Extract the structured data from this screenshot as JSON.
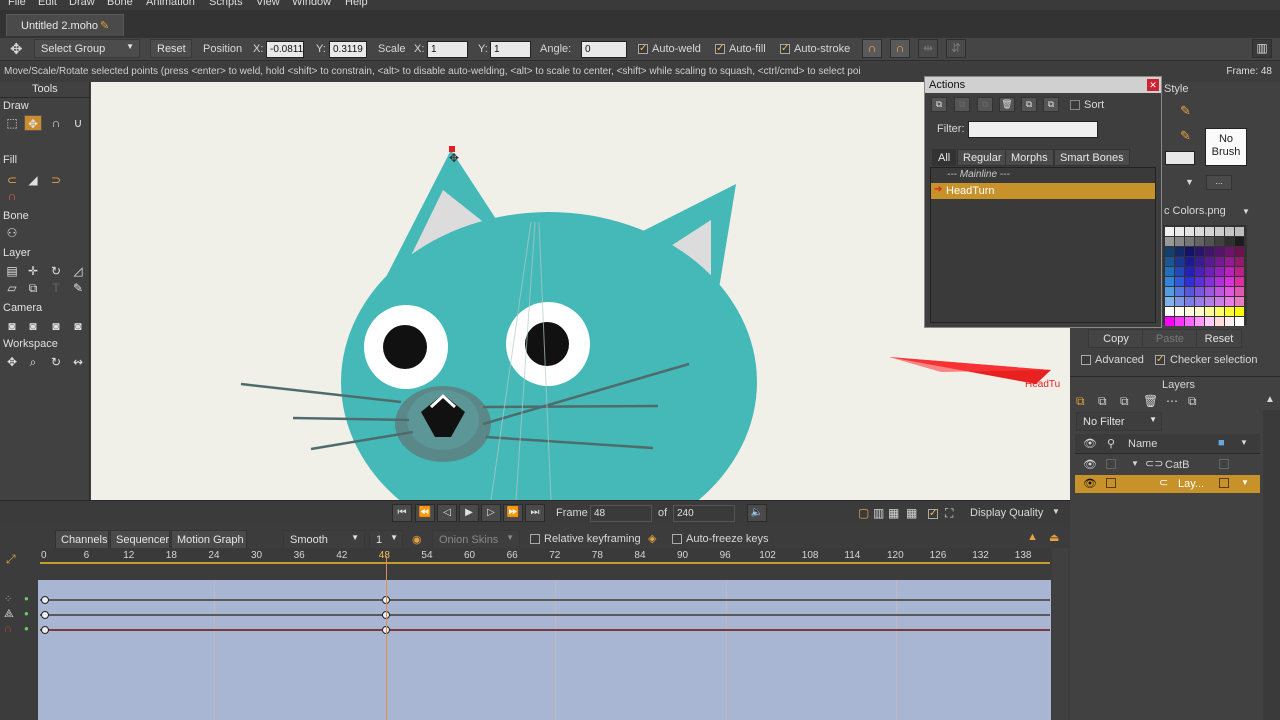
{
  "menubar": {
    "items": [
      "File",
      "Edit",
      "Draw",
      "Bone",
      "Animation",
      "Scripts",
      "View",
      "Window",
      "Help"
    ]
  },
  "document_tab": {
    "title": "Untitled 2.moho",
    "modified_icon": "pencil-icon"
  },
  "tool_options": {
    "select_group_label": "Select Group",
    "reset_label": "Reset",
    "position_label": "Position",
    "x_label": "X:",
    "x_value": "-0.0811",
    "y_label": "Y:",
    "y_value": "0.3119",
    "scale_label": "Scale",
    "scale_x_value": "1",
    "scale_y_value": "1",
    "angle_label": "Angle:",
    "angle_value": "0",
    "auto_weld": "Auto-weld",
    "auto_fill": "Auto-fill",
    "auto_stroke": "Auto-stroke"
  },
  "status": {
    "message": "Move/Scale/Rotate selected points (press <enter> to weld, hold <shift> to constrain, <alt> to disable auto-welding, <alt> to scale to center, <shift> while scaling to squash, <ctrl/cmd> to select poi",
    "frame_indicator": "Frame: 48"
  },
  "tools": {
    "title": "Tools",
    "sections": [
      "Draw",
      "Fill",
      "Bone",
      "Layer",
      "Camera",
      "Workspace"
    ]
  },
  "canvas": {
    "arrow_label": "HeadTu"
  },
  "timeline_controls": {
    "frame_label": "Frame",
    "frame_value": "48",
    "of_label": "of",
    "total_frames": "240",
    "display_quality": "Display Quality"
  },
  "timeline": {
    "tabs": [
      "Channels",
      "Sequencer",
      "Motion Graph"
    ],
    "interpolation": "Smooth",
    "interp_value": "1",
    "onion_skins": "Onion Skins",
    "relative_keyframing": "Relative keyframing",
    "auto_freeze": "Auto-freeze keys",
    "ruler_ticks": [
      0,
      6,
      12,
      18,
      24,
      30,
      36,
      42,
      48,
      54,
      60,
      66,
      72,
      78,
      84,
      90,
      96,
      102,
      108,
      114,
      120,
      126,
      132,
      138
    ],
    "current_frame": 48
  },
  "actions_panel": {
    "title": "Actions",
    "sort_label": "Sort",
    "filter_label": "Filter:",
    "filter_value": "",
    "tabs": [
      "All",
      "Regular",
      "Morphs",
      "Smart Bones"
    ],
    "items": [
      {
        "label": "--- Mainline ---",
        "selected": false
      },
      {
        "label": "HeadTurn",
        "selected": true
      }
    ]
  },
  "style_panel": {
    "title": "Style",
    "no_brush": "No Brush",
    "palette_name": "c Colors.png",
    "copy": "Copy",
    "paste": "Paste",
    "reset": "Reset",
    "advanced": "Advanced",
    "checker_selection": "Checker selection"
  },
  "layers_panel": {
    "title": "Layers",
    "filter": "No Filter",
    "name_header": "Name",
    "layers": [
      {
        "name": "CatB",
        "type": "bone-layer-icon",
        "selected": false
      },
      {
        "name": "Lay...",
        "type": "vector-layer-icon",
        "selected": true
      }
    ]
  },
  "colors": {
    "accent": "#d8a033",
    "selection": "#c7922a",
    "cat": "#45b8b8",
    "track_bg": "#a9b6d3"
  }
}
